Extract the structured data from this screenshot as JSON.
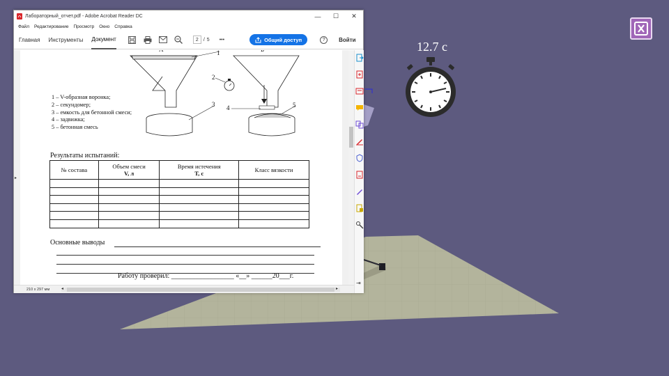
{
  "window": {
    "title": "Лабораторный_отчет.pdf - Adobe Acrobat Reader DC",
    "minimize_glyph": "—",
    "maximize_glyph": "☐",
    "close_glyph": "✕"
  },
  "menu": [
    "Файл",
    "Редактирование",
    "Просмотр",
    "Окно",
    "Справка"
  ],
  "toolbar": {
    "tabs": [
      "Главная",
      "Инструменты",
      "Документ"
    ],
    "active_tab": "Документ",
    "page_current": "2",
    "page_sep": "/",
    "page_total": "5",
    "more": "•••",
    "share_label": "Общий доступ",
    "help_glyph": "?",
    "login_label": "Войти"
  },
  "document": {
    "fig_labels": {
      "a": "А",
      "b": "Б",
      "n1": "1",
      "n2": "2",
      "n3": "3",
      "n4": "4",
      "n5": "5"
    },
    "legend": [
      "1 – V-образная воронка;",
      "2 – секундомер;",
      "3 – емкость для бетонной смеси;",
      "4 – задвижка;",
      "5 – бетонная смесь"
    ],
    "results_title": "Результаты испытаний:",
    "table": {
      "headers": [
        {
          "line1": "№ состава",
          "line2": ""
        },
        {
          "line1": "Объем смеси",
          "line2": "V, л"
        },
        {
          "line1": "Время истечения",
          "line2": "T, с"
        },
        {
          "line1": "Класс вязкости",
          "line2": ""
        }
      ],
      "empty_rows": 6
    },
    "conclusions_label": "Основные выводы",
    "checked_line": "Работу проверил: __________________ «__» ______20___г."
  },
  "statusbar": {
    "page_size": "210 x 297 мм",
    "scroll_left": "◂",
    "scroll_right": "▸",
    "collapse_glyph": "⇥"
  },
  "overlay": {
    "timer_text": "12.7 с"
  },
  "colors": {
    "background": "#5d5a7f",
    "share_button": "#1473e6",
    "exit_button": "#a066b8",
    "floor": "#b2b39b"
  }
}
